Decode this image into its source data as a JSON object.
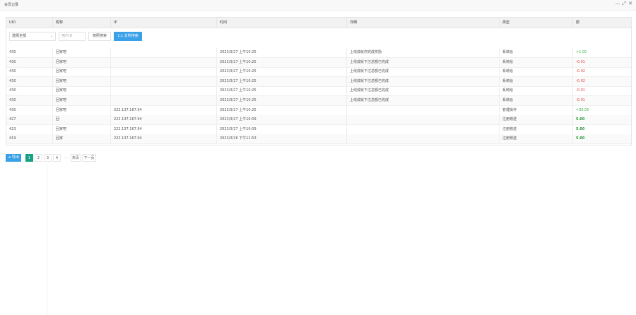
{
  "window": {
    "title": "会员记录",
    "controls": [
      "—",
      "⤢",
      "✕"
    ]
  },
  "table": {
    "columns": [
      "UID",
      "昵称",
      "IP",
      "时间",
      "详细",
      "类型",
      "额"
    ],
    "filters": {
      "select_value": "选择全部",
      "user_placeholder": "用户ID",
      "search_label": "按照搜索",
      "blue_label": "1.1 去所搜索"
    },
    "rows": [
      {
        "uid": "430",
        "name": "回家吧",
        "ip": "",
        "time": "2023/3/27 上午10:25",
        "detail": "上线成就你完成奖励",
        "type": "系统给",
        "amount": "+1.00",
        "tone": "pos"
      },
      {
        "uid": "430",
        "name": "回家吧",
        "ip": "",
        "time": "2023/3/27 上午10:25",
        "detail": "上线成就下注总额已完成",
        "type": "系统给",
        "amount": "-0.01",
        "tone": "neg"
      },
      {
        "uid": "430",
        "name": "回家吧",
        "ip": "",
        "time": "2023/3/27 上午10:25",
        "detail": "上线成就下注总额已完成",
        "type": "系统给",
        "amount": "-0.02",
        "tone": "neg"
      },
      {
        "uid": "430",
        "name": "回家吧",
        "ip": "",
        "time": "2023/3/27 上午10:25",
        "detail": "上线成就下注总额已完成",
        "type": "系统给",
        "amount": "-0.02",
        "tone": "neg"
      },
      {
        "uid": "430",
        "name": "回家吧",
        "ip": "",
        "time": "2023/3/27 上午10:25",
        "detail": "上线成就下注总额已完成",
        "type": "系统给",
        "amount": "-0.01",
        "tone": "neg"
      },
      {
        "uid": "430",
        "name": "回家吧",
        "ip": "",
        "time": "2023/3/27 上午10:25",
        "detail": "上线成就下注总额已完成",
        "type": "系统给",
        "amount": "-0.01",
        "tone": "neg"
      },
      {
        "uid": "430",
        "name": "回家吧",
        "ip": "222.137.167.94",
        "time": "2023/3/27 上午10:25",
        "detail": "",
        "type": "管理操作",
        "amount": "+30.00",
        "tone": "pos"
      },
      {
        "uid": "427",
        "name": "回",
        "ip": "222.137.167.94",
        "time": "2023/3/27 上午10:09",
        "detail": "",
        "type": "注册赠送",
        "amount": "5.00",
        "tone": "boldg"
      },
      {
        "uid": "423",
        "name": "回家吧",
        "ip": "222.137.167.94",
        "time": "2023/3/27 上午10:09",
        "detail": "",
        "type": "注册赠送",
        "amount": "5.00",
        "tone": "boldg"
      },
      {
        "uid": "419",
        "name": "回家",
        "ip": "222.137.167.94",
        "time": "2023/3/26 下午11:53",
        "detail": "",
        "type": "注册赠送",
        "amount": "5.00",
        "tone": "boldg"
      }
    ]
  },
  "pager": {
    "export_label": "➔ 导出",
    "pages": [
      "1",
      "2",
      "3",
      "4"
    ],
    "active": "1",
    "ellipsis": "...",
    "last_label": "末页",
    "next_label": "下一页"
  }
}
